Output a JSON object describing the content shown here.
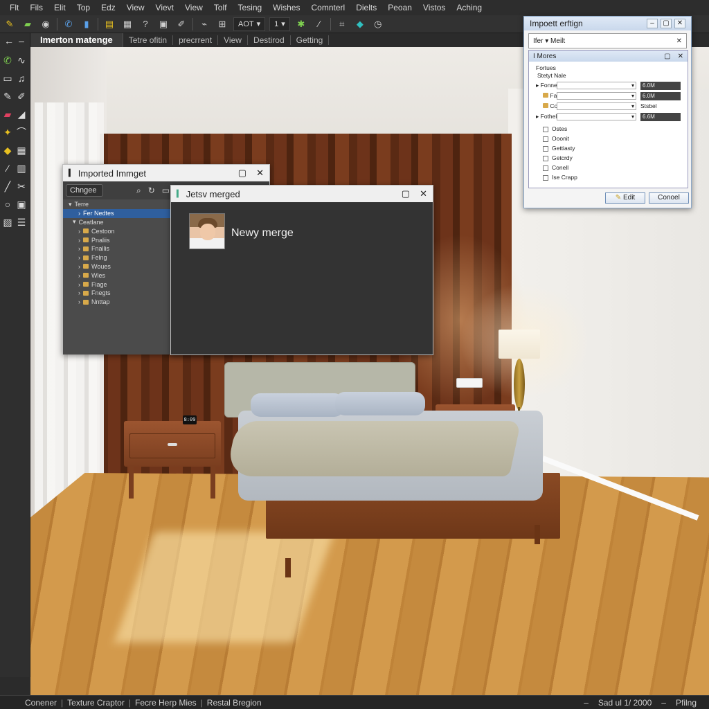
{
  "menu": [
    "Flt",
    "Fils",
    "Elit",
    "Top",
    "Edz",
    "View",
    "Vievt",
    "View",
    "Tolf",
    "Tesing",
    "Wishes",
    "Comnterl",
    "Dielts",
    "Peoan",
    "Vistos",
    "Aching"
  ],
  "toolbar": {
    "select_label": "AOT",
    "page_value": "1"
  },
  "tabs": {
    "active": "Imerton matenge",
    "items": [
      "Tetre ofitin",
      "precrrent",
      "View",
      "Destirod",
      "Getting"
    ]
  },
  "imported_window": {
    "title": "Imported Immget",
    "search_label": "Chngee",
    "tree": [
      {
        "label": "Terre",
        "level": 0,
        "arrow": "v"
      },
      {
        "label": "Fer Nedtes",
        "level": 1,
        "arrow": ">",
        "selected": true
      },
      {
        "label": "Ceatlane",
        "level": 1,
        "arrow": "v"
      },
      {
        "label": "Cestoon",
        "level": 2,
        "arrow": ">"
      },
      {
        "label": "Pnaliis",
        "level": 2,
        "arrow": ">"
      },
      {
        "label": "Fnallis",
        "level": 2,
        "arrow": ">"
      },
      {
        "label": "Felng",
        "level": 2,
        "arrow": ">"
      },
      {
        "label": "Woues",
        "level": 2,
        "arrow": ">"
      },
      {
        "label": "Wles",
        "level": 2,
        "arrow": ">"
      },
      {
        "label": "Fiage",
        "level": 2,
        "arrow": ">"
      },
      {
        "label": "Fnegts",
        "level": 2,
        "arrow": ">"
      },
      {
        "label": "Nnttap",
        "level": 2,
        "arrow": ">"
      }
    ]
  },
  "merged_window": {
    "title": "Jetsv merged",
    "heading": "Newy merge"
  },
  "import_dialog": {
    "title": "Impoett erftign",
    "filter_label": "Ifer",
    "filter_value": "Meilt",
    "subpanel_title": "I Mores",
    "section_label": "Fortues",
    "name_label": "Stetyt Nale",
    "props": [
      {
        "label": "Fonne Nedtty",
        "value": "6.0M",
        "expand": true
      },
      {
        "label": "Falt",
        "value": "6.0M",
        "folder": true
      },
      {
        "label": "Contas",
        "value": "Stsbel",
        "folder": true
      },
      {
        "label": "Fothell",
        "value": "6.6M",
        "expand": true
      }
    ],
    "checks": [
      "Ostes",
      "Ooonit",
      "Gettiasty",
      "Getcrdy",
      "Conell",
      "Ise Crapp"
    ],
    "ok_label": "Edit",
    "cancel_label": "Conoel"
  },
  "scene": {
    "clock_text": "8:09"
  },
  "status": {
    "items": [
      "Conener",
      "Texture Craptor",
      "Fecre Herp Mies",
      "Restal Bregion"
    ],
    "right": [
      "Sad ul 1/ 2000",
      "Pfilng"
    ]
  }
}
